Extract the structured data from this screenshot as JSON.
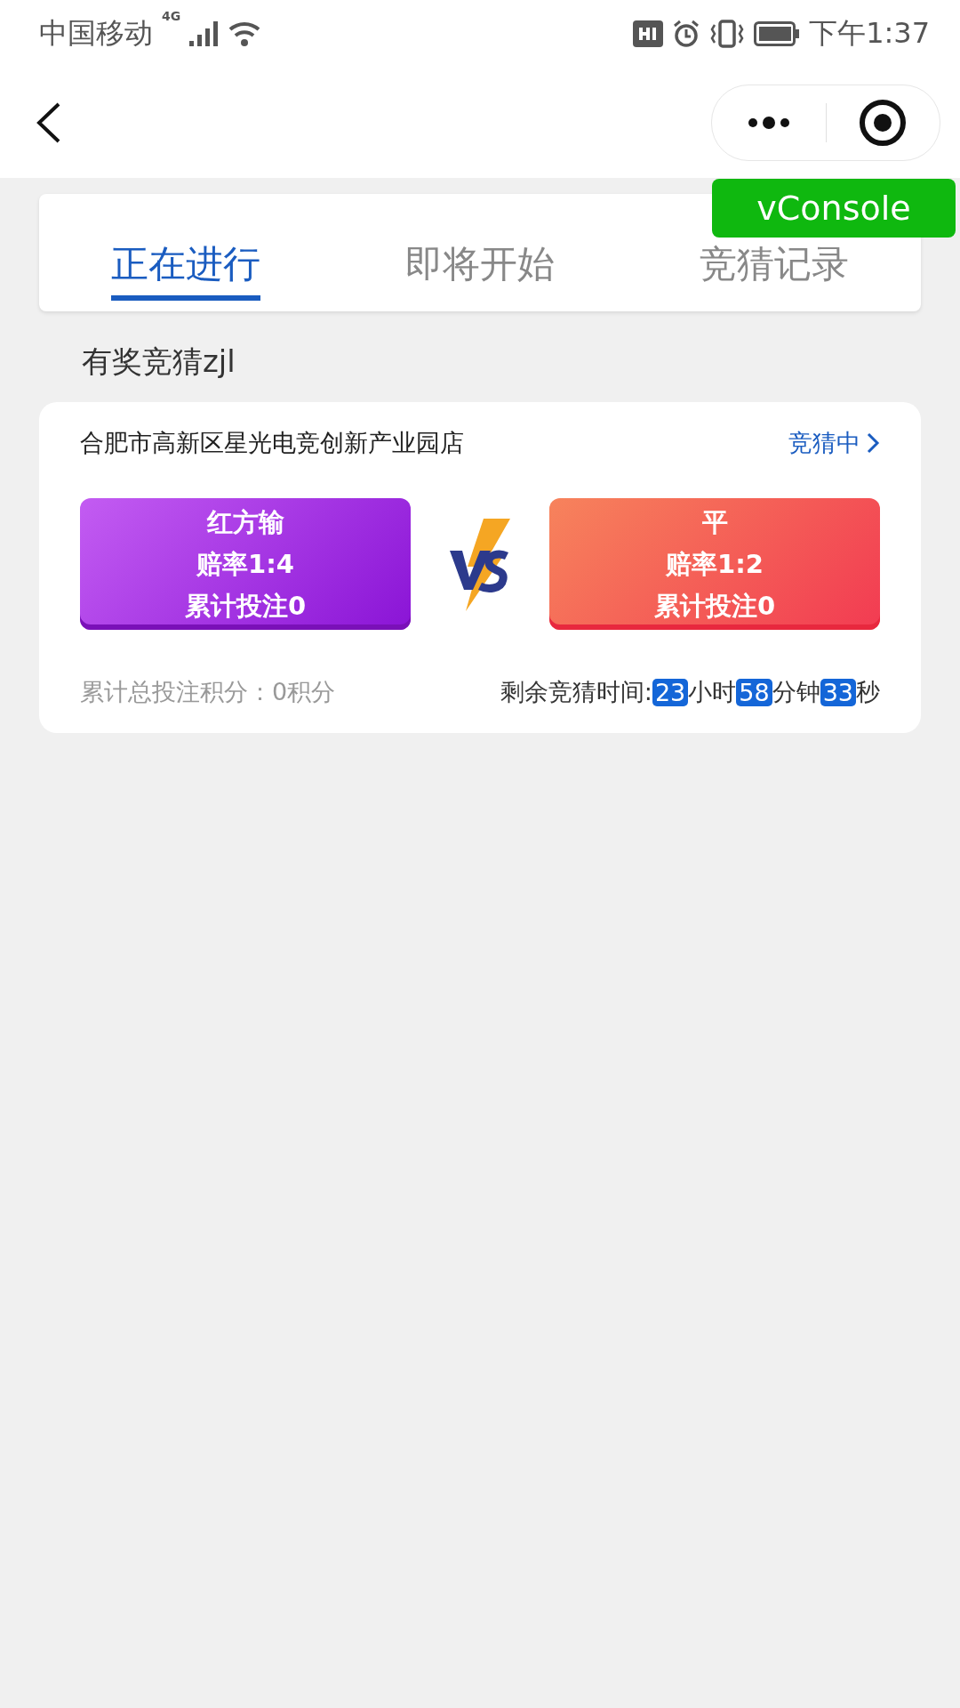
{
  "status_bar": {
    "carrier": "中国移动",
    "network": "4G",
    "time": "下午1:37"
  },
  "tabs": [
    {
      "label": "正在进行",
      "selected": true
    },
    {
      "label": "即将开始",
      "selected": false
    },
    {
      "label": "竞猜记录",
      "selected": false
    }
  ],
  "vconsole": {
    "label": "vConsole"
  },
  "section_title": "有奖竞猜zjl",
  "match": {
    "store": "合肥市高新区星光电竞创新产业园店",
    "status": "竞猜中",
    "options": [
      {
        "kind": "purple",
        "title": "红方输",
        "odds": "赔率1:4",
        "bets": "累计投注0"
      },
      {
        "kind": "red",
        "title": "平",
        "odds": "赔率1:2",
        "bets": "累计投注0"
      }
    ],
    "total": "累计总投注积分：0积分",
    "timer": {
      "label": "剩余竞猜时间:",
      "parts": [
        {
          "value": "23",
          "unit": "小时"
        },
        {
          "value": "58",
          "unit": "分钟"
        },
        {
          "value": "33",
          "unit": "秒"
        }
      ]
    }
  }
}
